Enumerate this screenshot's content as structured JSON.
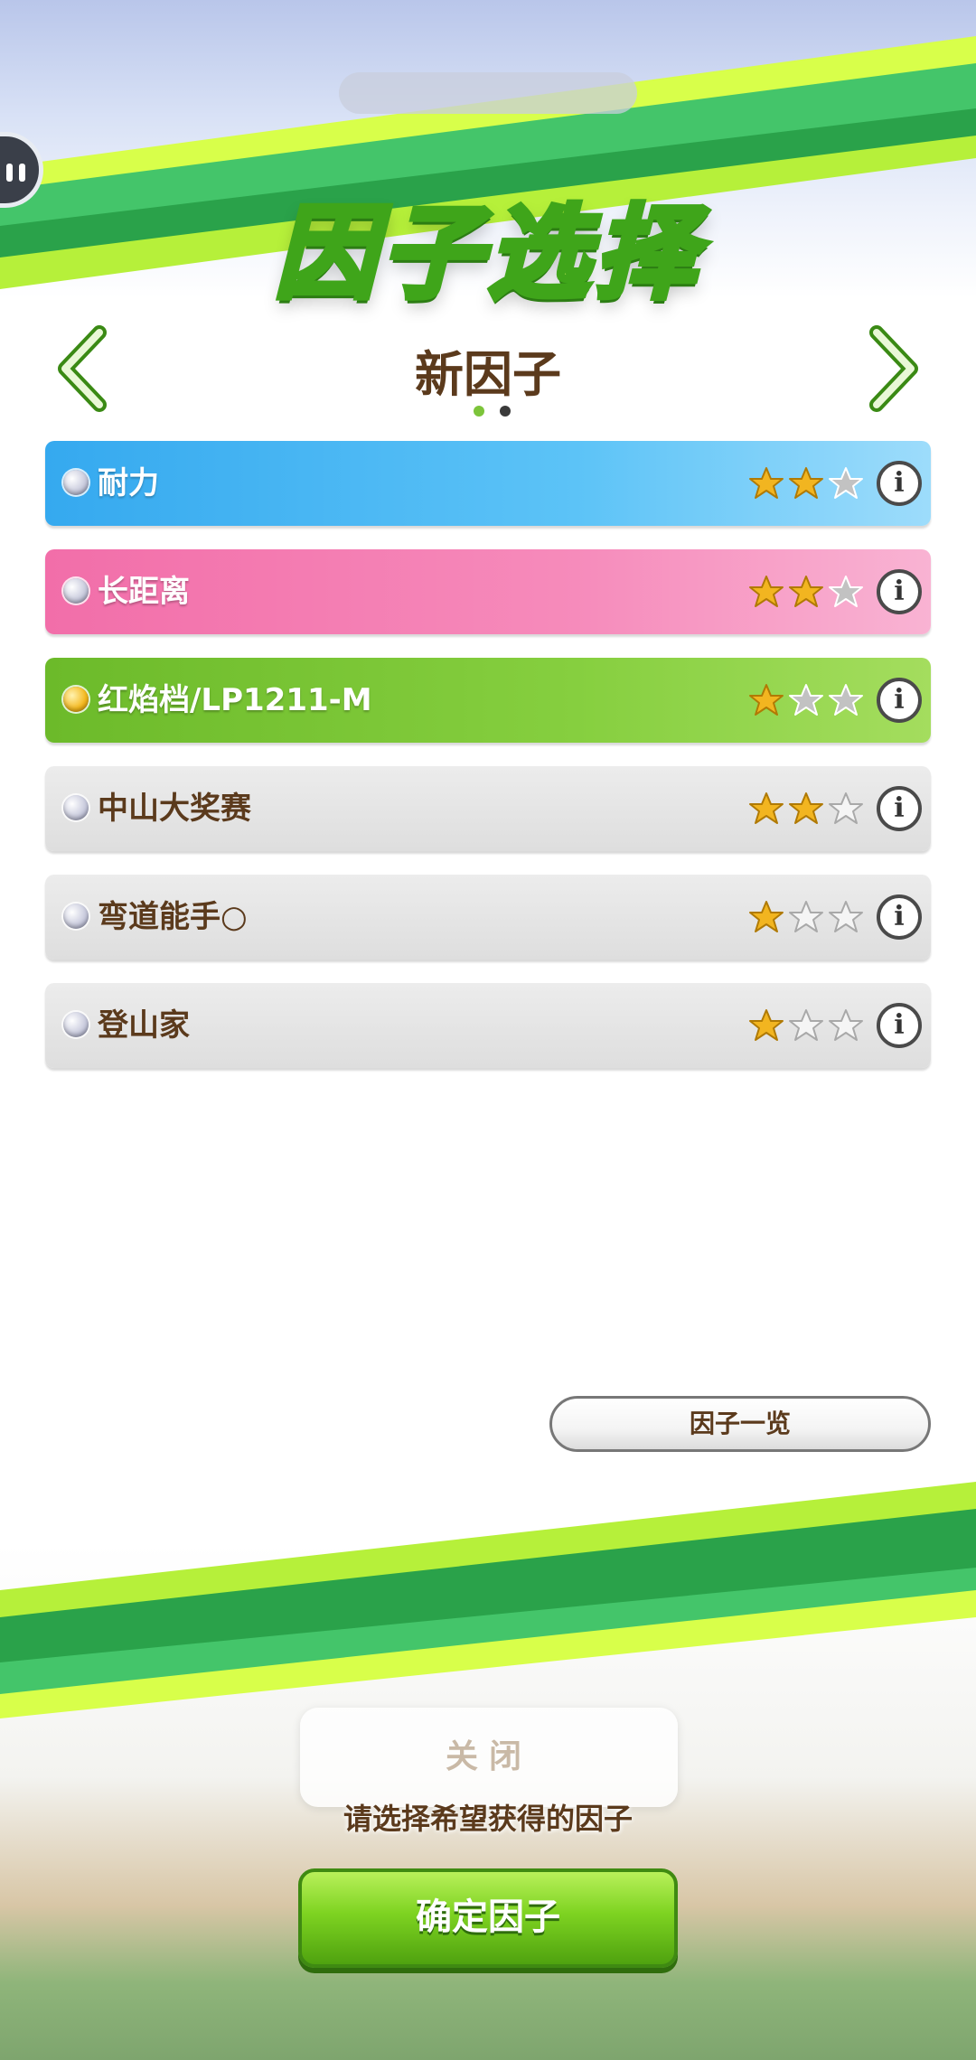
{
  "topbar": {
    "pill_text": ""
  },
  "header": {
    "title": "因子选择",
    "subtitle": "新因子"
  },
  "pager": {
    "pages": 2,
    "active": 1
  },
  "colors": {
    "blue": "#3fb2f2",
    "pink": "#f47fb2",
    "green": "#7cc43a",
    "gray": "#e2e2e2",
    "star_on": "#f2b520",
    "star_off_bg": "#bfbfbf",
    "brand_green": "#6cc51f"
  },
  "factors": [
    {
      "name": "耐力",
      "color": "blue",
      "stars": 2,
      "max": 3,
      "orb": "silver"
    },
    {
      "name": "长距离",
      "color": "pink",
      "stars": 2,
      "max": 3,
      "orb": "silver"
    },
    {
      "name": "红焰档/LP1211-M",
      "color": "green",
      "stars": 1,
      "max": 3,
      "orb": "gold"
    },
    {
      "name": "中山大奖赛",
      "color": "gray",
      "stars": 2,
      "max": 3,
      "orb": "silver"
    },
    {
      "name": "弯道能手○",
      "color": "gray",
      "stars": 1,
      "max": 3,
      "orb": "silver"
    },
    {
      "name": "登山家",
      "color": "gray",
      "stars": 1,
      "max": 3,
      "orb": "silver"
    }
  ],
  "buttons": {
    "factor_list": "因子一览",
    "close_ghost": "关闭",
    "confirm": "确定因子"
  },
  "prompt": "请选择希望获得的因子"
}
